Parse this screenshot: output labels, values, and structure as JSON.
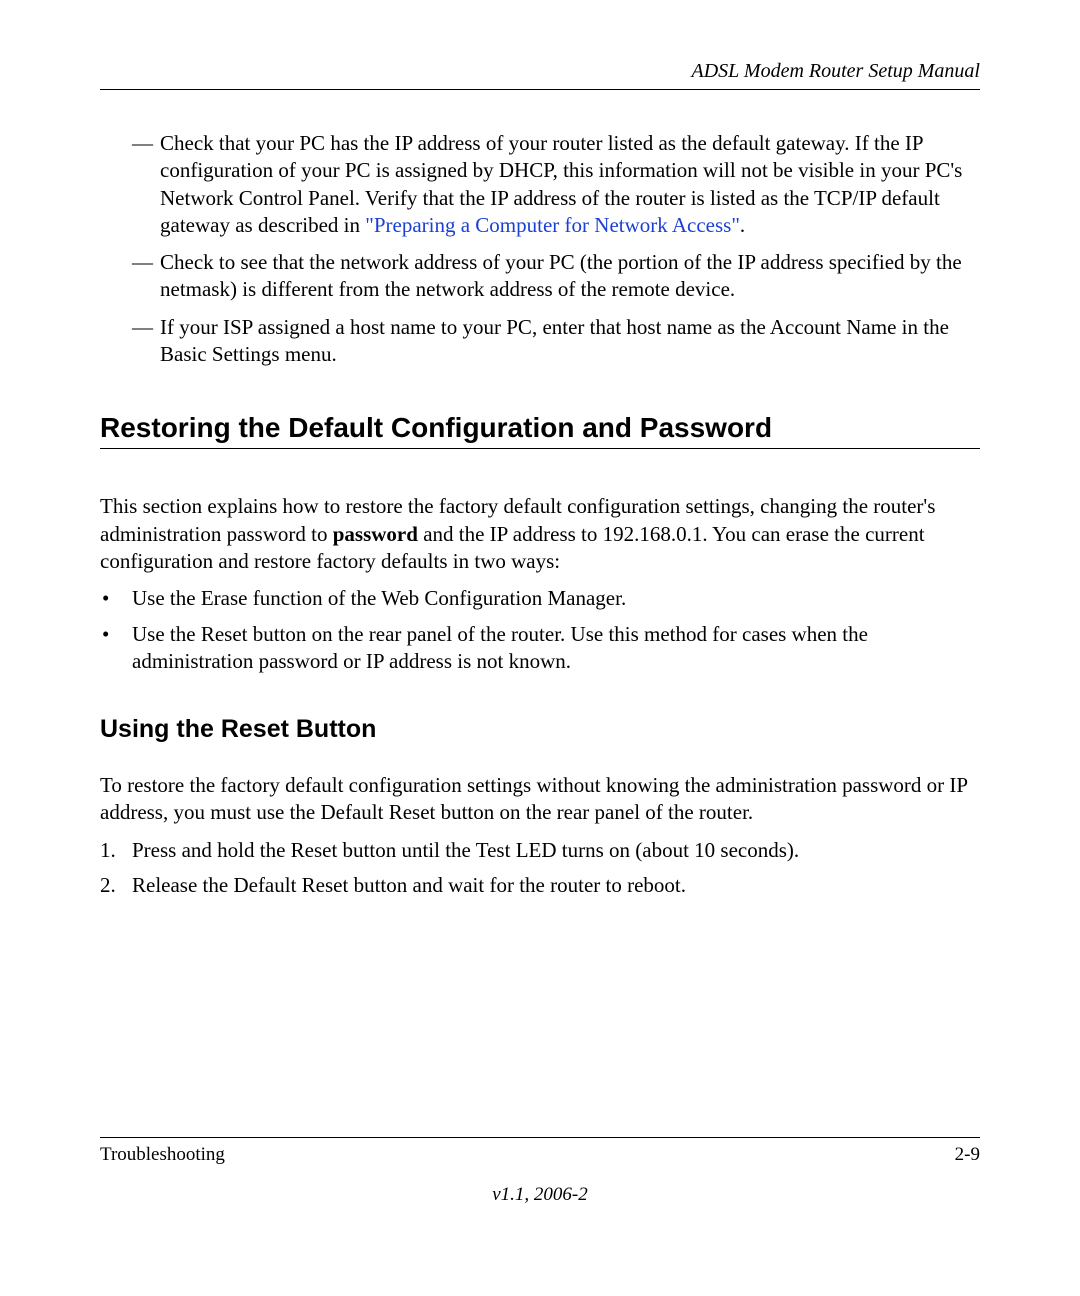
{
  "header": {
    "title": "ADSL Modem Router Setup Manual"
  },
  "dashItems": {
    "item1_before": "Check that your PC has the IP address of your router listed as the default gateway. If the IP configuration of your PC is assigned by DHCP, this information will not be visible in your PC's Network Control Panel. Verify that the IP address of the router is listed as the TCP/IP default gateway as described in ",
    "item1_link": "\"Preparing a Computer for Network Access\"",
    "item1_after": ".",
    "item2": "Check to see that the network address of your PC (the portion of the IP address specified by the netmask) is different from the network address of the remote device.",
    "item3": "If your ISP assigned a host name to your PC, enter that host name as the Account Name in the Basic Settings menu."
  },
  "section1": {
    "heading": "Restoring the Default Configuration and Password",
    "para_before": "This section explains how to restore the factory default configuration settings, changing the router's administration password to ",
    "para_bold": "password",
    "para_after": " and the IP address to 192.168.0.1. You can erase the current configuration and restore factory defaults in two ways:",
    "bullets": {
      "b1": "Use the Erase function of the Web Configuration Manager.",
      "b2": "Use the Reset button on the rear panel of the router. Use this method for cases when the administration password or IP address is not known."
    }
  },
  "section2": {
    "heading": "Using the Reset Button",
    "para": "To restore the factory default configuration settings without knowing the administration password or IP address, you must use the Default Reset button on the rear panel of the router.",
    "steps": {
      "s1": "Press and hold the Reset button until the Test LED turns on (about 10 seconds).",
      "s2": "Release the Default Reset button and wait for the router to reboot."
    }
  },
  "footer": {
    "left": "Troubleshooting",
    "right": "2-9",
    "version": "v1.1, 2006-2"
  }
}
